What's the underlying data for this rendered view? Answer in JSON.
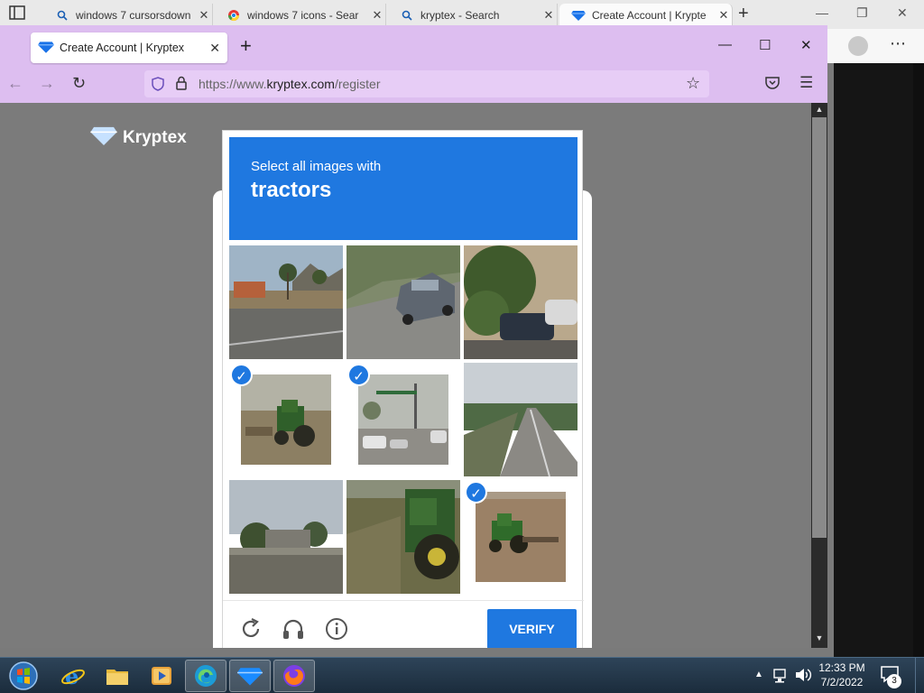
{
  "edge": {
    "tabs": [
      {
        "label": "windows 7 cursorsdown",
        "icon": "search-icon",
        "active": false
      },
      {
        "label": "windows 7 icons - Sear",
        "icon": "chrome-icon",
        "active": false
      },
      {
        "label": "kryptex - Search",
        "icon": "search-icon",
        "active": false
      },
      {
        "label": "Create Account | Krypte",
        "icon": "kryptex-diamond-icon",
        "active": true
      }
    ]
  },
  "firefox": {
    "tab_label": "Create Account | Kryptex",
    "url_prefix": "https://www.",
    "url_domain": "kryptex.com",
    "url_path": "/register"
  },
  "page": {
    "brand": "Kryptex"
  },
  "captcha": {
    "instruction": "Select all images with",
    "target": "tractors",
    "tiles": [
      {
        "subject": "desert street with palm trees",
        "selected": false
      },
      {
        "subject": "grey car on street",
        "selected": false
      },
      {
        "subject": "tree and parked cars",
        "selected": false
      },
      {
        "subject": "green tractor in field",
        "selected": true
      },
      {
        "subject": "street intersection with cars",
        "selected": true
      },
      {
        "subject": "rural road",
        "selected": false
      },
      {
        "subject": "roadside with palm trees",
        "selected": false
      },
      {
        "subject": "green tractor close-up",
        "selected": true
      },
      {
        "subject": "tractor on dirt field",
        "selected": true
      }
    ],
    "verify_label": "VERIFY",
    "accent": "#1f78e0"
  },
  "taskbar": {
    "apps": [
      "internet-explorer",
      "file-explorer",
      "media-player",
      "edge",
      "kryptex",
      "firefox"
    ],
    "time": "12:33 PM",
    "date": "7/2/2022",
    "notifications": "3"
  }
}
